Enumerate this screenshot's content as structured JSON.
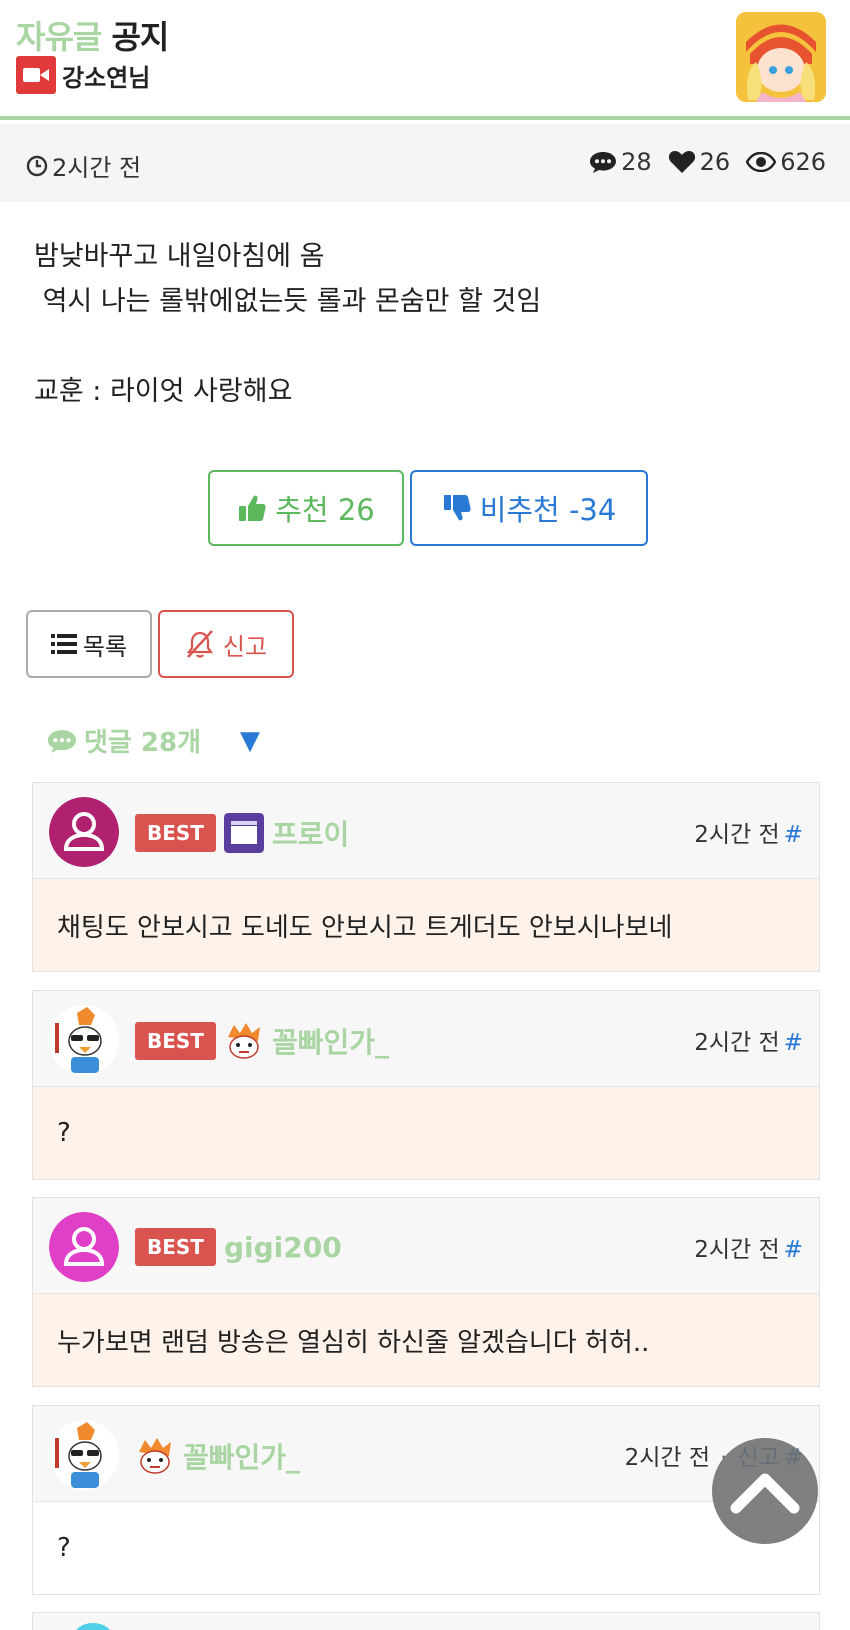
{
  "header": {
    "board_name": "자유글",
    "board_type": "공지",
    "author": "강소연님"
  },
  "meta": {
    "time": "2시간 전",
    "comments": "28",
    "likes": "26",
    "views": "626"
  },
  "post": {
    "text": "밤낮바꾸고 내일아침에 옴\n 역시 나는 롤밖에없는듯 롤과 몬숨만 할 것임\n\n교훈 : 라이엇 사랑해요"
  },
  "votes": {
    "up_label": "추천 26",
    "down_label": "비추천 -34"
  },
  "actions": {
    "list_label": "목록",
    "report_label": "신고"
  },
  "comments_header": {
    "label": "댓글 28개",
    "toggle": "▼"
  },
  "comments": [
    {
      "badge": "BEST",
      "nickname": "프로이",
      "time": "2시간 전",
      "hash": "#",
      "text": "채팅도 안보시고 도네도 안보시고 트게더도 안보시나보네"
    },
    {
      "badge": "BEST",
      "nickname": "꼴빠인가_",
      "time": "2시간 전",
      "hash": "#",
      "text": "?"
    },
    {
      "badge": "BEST",
      "nickname": "gigi200",
      "time": "2시간 전",
      "hash": "#",
      "text": "누가보면 랜덤 방송은 열심히 하신줄 알겠습니다 허허.."
    },
    {
      "nickname": "꼴빠인가_",
      "time": "2시간 전",
      "report": "신고",
      "hash": "#",
      "text": "?"
    }
  ],
  "colors": {
    "accent_green": "#a8d5a2",
    "best_red": "#d9534f",
    "link_blue": "#2a7ad5",
    "best_body_bg": "#fdf3ea"
  }
}
